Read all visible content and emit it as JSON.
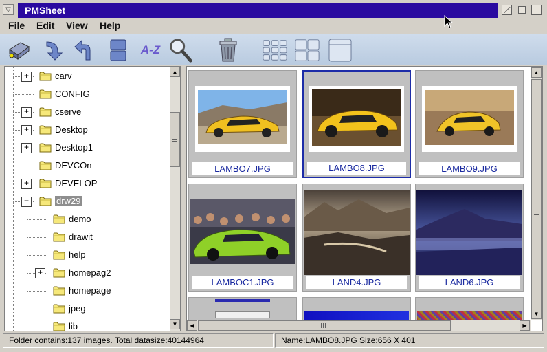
{
  "window": {
    "title": "PMSheet"
  },
  "menu": [
    "File",
    "Edit",
    "View",
    "Help"
  ],
  "toolbar": {
    "sort_label": "A-Z",
    "icons": [
      "disk-drive-icon",
      "move-down-arrow-icon",
      "undo-arrow-icon",
      "stack-icon",
      "sort-az-icon",
      "magnifier-icon",
      "trash-icon",
      "small-grid-icon",
      "medium-grid-icon",
      "large-view-icon"
    ]
  },
  "tree": [
    {
      "label": "carv",
      "expander": "+"
    },
    {
      "label": "CONFIG",
      "expander": ""
    },
    {
      "label": "cserve",
      "expander": "+"
    },
    {
      "label": "Desktop",
      "expander": "+"
    },
    {
      "label": "Desktop1",
      "expander": "+"
    },
    {
      "label": "DEVCOn",
      "expander": ""
    },
    {
      "label": "DEVELOP",
      "expander": "+"
    },
    {
      "label": "drw29",
      "expander": "−",
      "selected": true
    },
    {
      "label": "demo",
      "expander": ""
    },
    {
      "label": "drawit",
      "expander": ""
    },
    {
      "label": "help",
      "expander": ""
    },
    {
      "label": "homepag2",
      "expander": "+"
    },
    {
      "label": "homepage",
      "expander": ""
    },
    {
      "label": "jpeg",
      "expander": ""
    },
    {
      "label": "lib",
      "expander": ""
    }
  ],
  "thumbnails": [
    {
      "name": "LAMBO7.JPG",
      "selected": false
    },
    {
      "name": "LAMBO8.JPG",
      "selected": true
    },
    {
      "name": "LAMBO9.JPG",
      "selected": false
    },
    {
      "name": "LAMBOC1.JPG",
      "selected": false
    },
    {
      "name": "LAND4.JPG",
      "selected": false
    },
    {
      "name": "LAND6.JPG",
      "selected": false
    }
  ],
  "status": {
    "folder_info": "Folder contains:137 images. Total datasize:40144964",
    "file_info": "Name:LAMBO8.JPG Size:656 X 401"
  },
  "colors": {
    "titlebar": "#2a0aa0",
    "caption_text": "#1a2aa0",
    "toolbar": "#c4d4e6"
  }
}
